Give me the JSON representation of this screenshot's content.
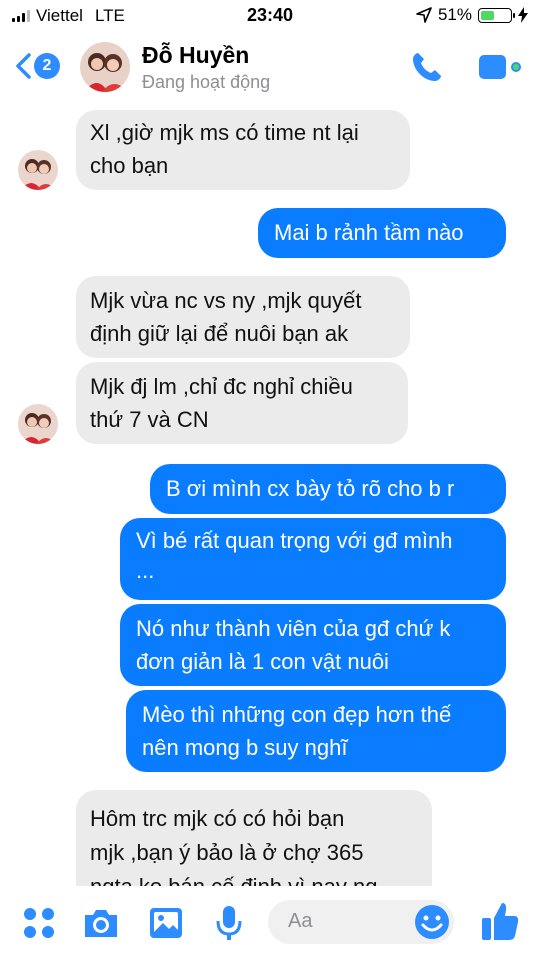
{
  "status_bar": {
    "carrier": "Viettel",
    "network": "LTE",
    "time": "23:40",
    "battery": "51%",
    "battery_level": 0.51
  },
  "header": {
    "unread_count": "2",
    "contact_name": "Đỗ Huyền",
    "contact_status": "Đang hoạt động",
    "accent_color": "#2d8cff"
  },
  "messages": [
    {
      "side": "in",
      "lines": [
        "Xl ,giờ mjk ms có time nt lại",
        "cho bạn"
      ]
    },
    {
      "side": "out",
      "lines": [
        "Mai b rảnh tầm nào"
      ]
    },
    {
      "side": "in",
      "lines": [
        "Mjk vừa nc vs ny ,mjk quyết",
        "định giữ lại để nuôi bạn ak"
      ]
    },
    {
      "side": "in",
      "lines": [
        "Mjk đj lm ,chỉ đc nghỉ chiều",
        "thứ 7 và CN"
      ]
    },
    {
      "side": "out",
      "lines": [
        "B ơi mình cx bày tỏ rõ cho b r"
      ]
    },
    {
      "side": "out",
      "lines": [
        "Vì bé rất quan trọng với gđ mình",
        "..."
      ]
    },
    {
      "side": "out",
      "lines": [
        "Nó như thành viên của gđ chứ k",
        "đơn giản là 1 con vật nuôi"
      ]
    },
    {
      "side": "out",
      "lines": [
        "Mèo thì những con đẹp hơn thế",
        "nên mong b suy nghĩ"
      ]
    },
    {
      "side": "in",
      "lines": [
        "Hôm trc mjk có có hỏi bạn",
        "mjk ,bạn ý bảo là ở chợ 365",
        "ngta ko bán cố định vì nay ng"
      ]
    }
  ],
  "composer": {
    "placeholder": "Aa",
    "icons": [
      "apps-icon",
      "camera-icon",
      "photo-icon",
      "microphone-icon",
      "emoji-icon",
      "thumbs-up-icon"
    ]
  },
  "colors": {
    "outgoing_bubble": "#0a7cff",
    "incoming_bubble": "#ebebeb"
  }
}
